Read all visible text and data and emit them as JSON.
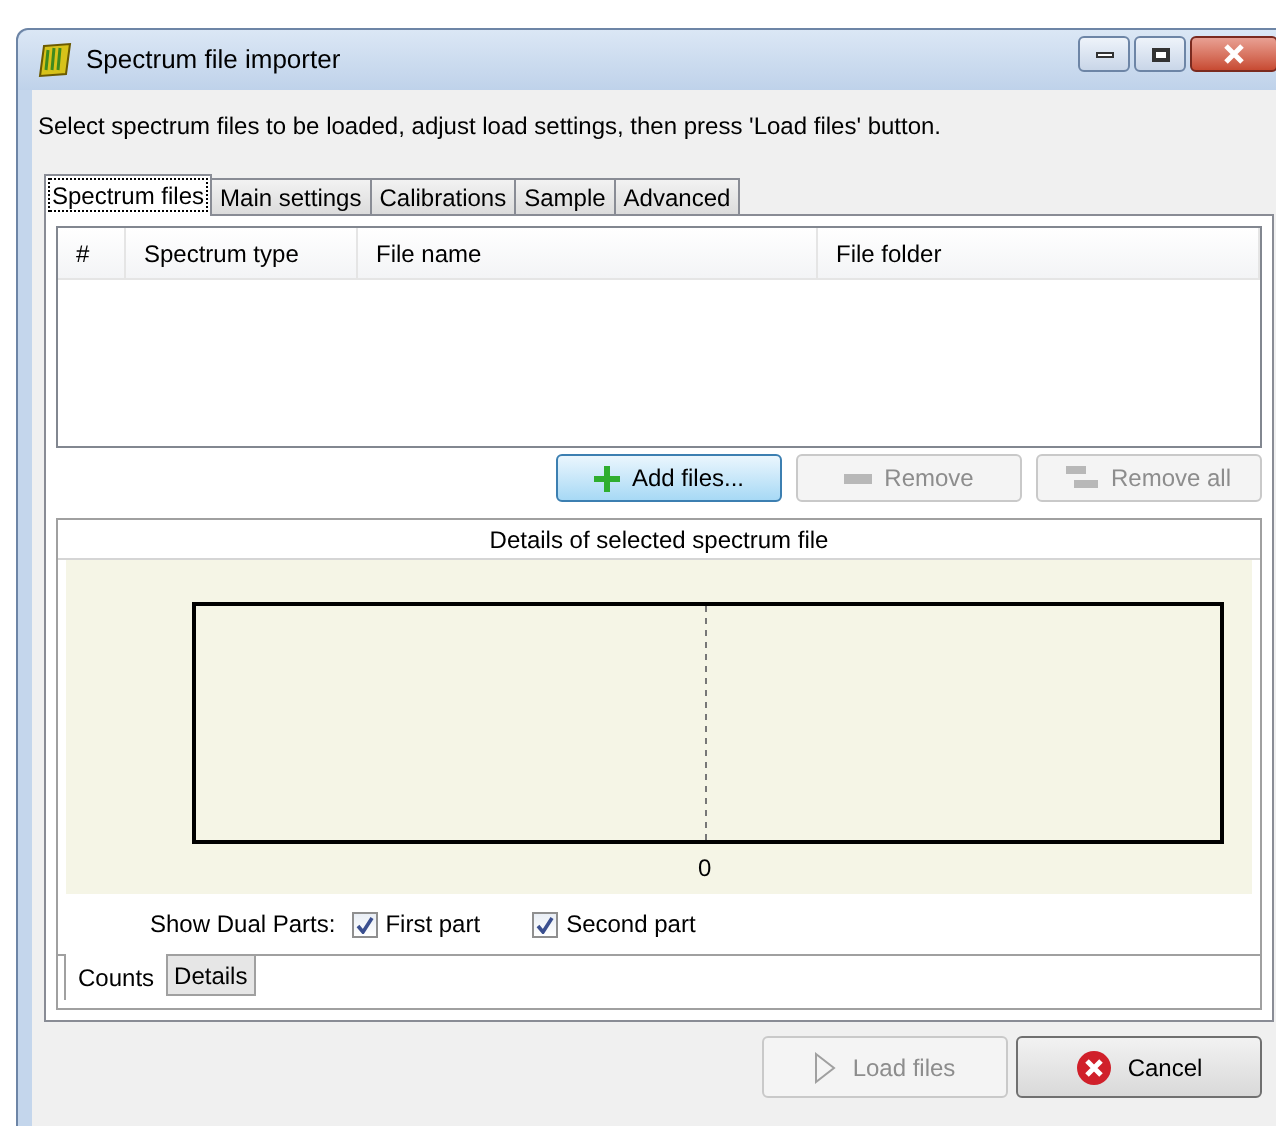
{
  "window": {
    "title": "Spectrum file importer"
  },
  "instruction": "Select spectrum files to be loaded, adjust load settings, then press 'Load files' button.",
  "tabs": [
    {
      "label": "Spectrum files",
      "selected": true
    },
    {
      "label": "Main settings",
      "selected": false
    },
    {
      "label": "Calibrations",
      "selected": false
    },
    {
      "label": "Sample",
      "selected": false
    },
    {
      "label": "Advanced",
      "selected": false
    }
  ],
  "table": {
    "columns": [
      "#",
      "Spectrum type",
      "File name",
      "File folder"
    ]
  },
  "file_buttons": [
    {
      "kind": "add",
      "label": "Add files...",
      "disabled": false
    },
    {
      "kind": "remove",
      "label": "Remove",
      "disabled": true
    },
    {
      "kind": "remove_all",
      "label": "Remove all",
      "disabled": true
    }
  ],
  "details": {
    "title": "Details of selected spectrum file",
    "tick_label": "0",
    "dual_label": "Show Dual Parts:",
    "checkboxes": [
      {
        "label": "First part",
        "checked": true
      },
      {
        "label": "Second part",
        "checked": true
      }
    ],
    "tabs": [
      {
        "label": "Counts",
        "selected": true
      },
      {
        "label": "Details",
        "selected": false
      }
    ]
  },
  "buttons": [
    {
      "kind": "load",
      "label": "Load files",
      "disabled": true
    },
    {
      "kind": "cancel",
      "label": "Cancel",
      "disabled": false
    }
  ]
}
